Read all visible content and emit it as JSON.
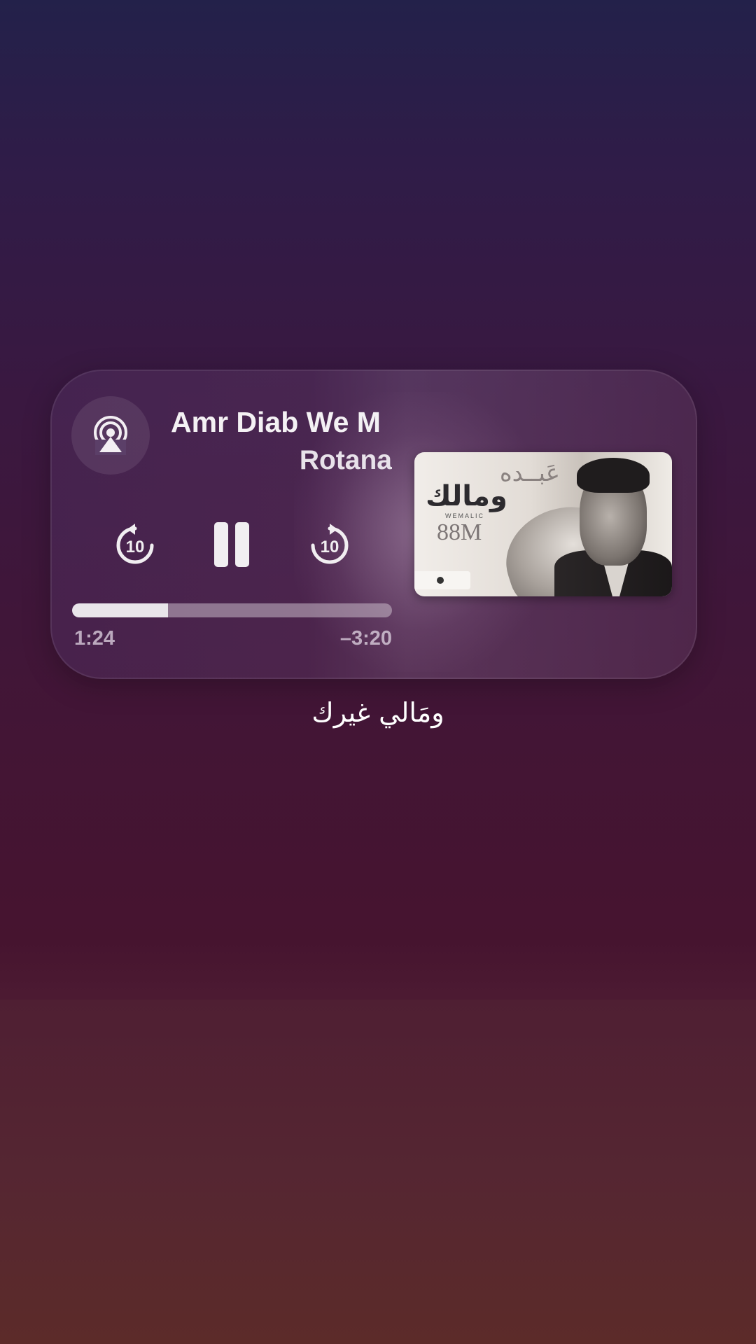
{
  "colors": {
    "background_top": "#23214a",
    "background_mid": "#431535",
    "background_bottom": "#5c2a2a",
    "text_primary": "#f4f1f4",
    "text_secondary": "#e8e2ea"
  },
  "player": {
    "airplay_icon": "airplay-audio-icon",
    "title": "Amr Diab We M",
    "artist": "Rotana",
    "controls": {
      "skip_back_label": "10",
      "skip_forward_label": "10",
      "play_state": "pause"
    },
    "progress": {
      "fraction": 0.3,
      "elapsed": "1:24",
      "remaining": "–3:20"
    },
    "artwork": {
      "arabic_top": "عَبــده",
      "arabic_main": "ومالك",
      "subtitle": "WEMALIC",
      "label_88": "88M"
    }
  },
  "lyric": "ومَالي غيرك"
}
